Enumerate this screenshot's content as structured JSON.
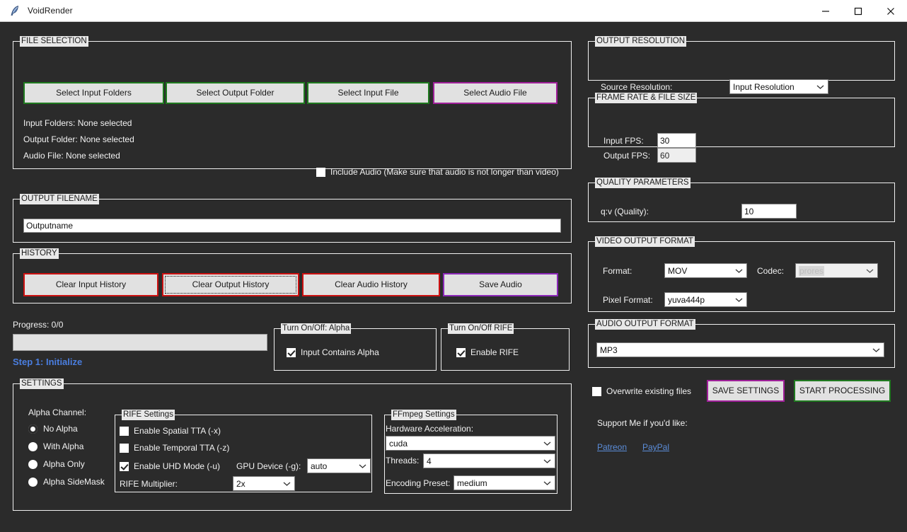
{
  "window": {
    "title": "VoidRender",
    "icon": "feather-icon",
    "controls": {
      "minimize": "minimize-icon",
      "maximize": "maximize-icon",
      "close": "close-icon"
    }
  },
  "colors": {
    "bg": "#2b2b2b",
    "accent_green": "#1f7a1f",
    "accent_magenta": "#a0209a",
    "accent_red": "#cc1111",
    "accent_purple": "#8b28b8",
    "step_text": "#4a7ee0",
    "link": "#5b8dd9"
  },
  "file_selection": {
    "legend": "FILE SELECTION",
    "buttons": [
      {
        "label": "Select Input Folders",
        "style": "green"
      },
      {
        "label": "Select Output Folder",
        "style": "green"
      },
      {
        "label": "Select Input File",
        "style": "green"
      },
      {
        "label": "Select Audio File",
        "style": "magenta"
      }
    ],
    "status": [
      "Input Folders: None selected",
      "Output Folder: None selected",
      "Audio File: None selected"
    ],
    "include_audio": {
      "label": "Include Audio (Make sure that audio is not longer than video)",
      "checked": false
    }
  },
  "output_filename": {
    "legend": "OUTPUT FILENAME",
    "value": "Outputname"
  },
  "history": {
    "legend": "HISTORY",
    "buttons": [
      {
        "label": "Clear Input History",
        "style": "red"
      },
      {
        "label": "Clear Output History",
        "style": "focus"
      },
      {
        "label": "Clear Audio History",
        "style": "red"
      },
      {
        "label": "Save Audio",
        "style": "purple"
      }
    ]
  },
  "progress": {
    "label": "Progress: 0/0",
    "percent": 0,
    "step": "Step 1: Initialize"
  },
  "toggle_alpha": {
    "legend": "Turn On/Off: Alpha",
    "checkbox": {
      "label": "Input Contains Alpha",
      "checked": true
    }
  },
  "toggle_rife": {
    "legend": "Turn On/Off RIFE",
    "checkbox": {
      "label": "Enable RIFE",
      "checked": true
    }
  },
  "settings": {
    "legend": "SETTINGS",
    "alpha_channel": {
      "label": "Alpha Channel:",
      "options": [
        "No Alpha",
        "With Alpha",
        "Alpha Only",
        "Alpha SideMask"
      ],
      "selected": "No Alpha"
    },
    "rife": {
      "legend": "RIFE Settings",
      "checkboxes": [
        {
          "label": "Enable Spatial TTA (-x)",
          "checked": false
        },
        {
          "label": "Enable Temporal TTA (-z)",
          "checked": false
        },
        {
          "label": "Enable UHD Mode (-u)",
          "checked": true
        }
      ],
      "gpu_device": {
        "label": "GPU Device (-g):",
        "value": "auto"
      },
      "multiplier": {
        "label": "RIFE Multiplier:",
        "value": "2x"
      }
    },
    "ffmpeg": {
      "legend": "FFmpeg Settings",
      "hwaccel": {
        "label": "Hardware Acceleration:",
        "value": "cuda"
      },
      "threads": {
        "label": "Threads:",
        "value": "4"
      },
      "preset": {
        "label": "Encoding Preset:",
        "value": "medium"
      }
    }
  },
  "output_resolution": {
    "legend": "OUTPUT RESOLUTION",
    "source_label": "Source Resolution:",
    "source_value": "Input Resolution"
  },
  "frame_rate": {
    "legend": "FRAME RATE & FILE SIZE",
    "input_fps": {
      "label": "Input FPS:",
      "value": "30",
      "disabled": false
    },
    "output_fps": {
      "label": "Output FPS:",
      "value": "60",
      "disabled": true
    }
  },
  "quality": {
    "legend": "QUALITY PARAMETERS",
    "qv": {
      "label": "q:v (Quality):",
      "value": "10"
    }
  },
  "video_output": {
    "legend": "VIDEO OUTPUT FORMAT",
    "format": {
      "label": "Format:",
      "value": "MOV"
    },
    "codec": {
      "label": "Codec:",
      "value": "prores",
      "disabled": true
    },
    "pixel_format": {
      "label": "Pixel Format:",
      "value": "yuva444p"
    }
  },
  "audio_output": {
    "legend": "AUDIO OUTPUT FORMAT",
    "value": "MP3"
  },
  "actions": {
    "overwrite": {
      "label": "Overwrite existing files",
      "checked": false
    },
    "save_settings": "SAVE SETTINGS",
    "start_processing": "START PROCESSING"
  },
  "support": {
    "label": "Support Me if you'd like:",
    "links": [
      "Patreon",
      "PayPal"
    ]
  }
}
